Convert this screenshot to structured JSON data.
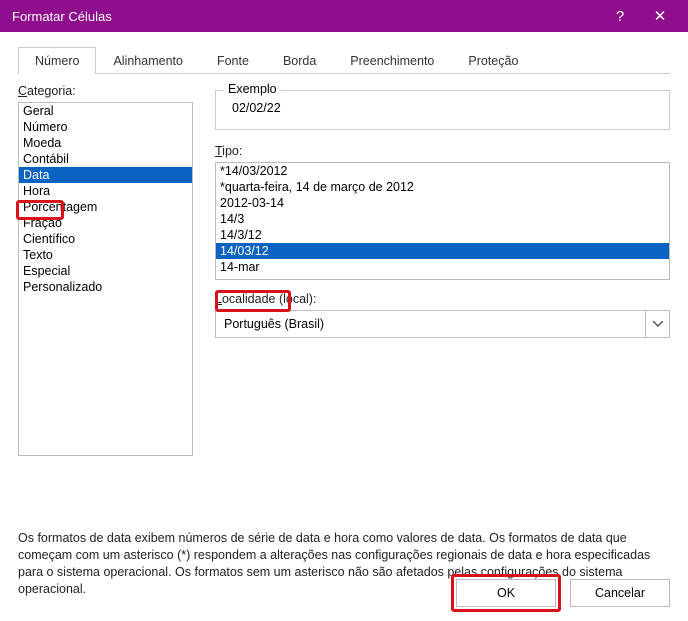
{
  "title": "Formatar Células",
  "tabs": [
    "Número",
    "Alinhamento",
    "Fonte",
    "Borda",
    "Preenchimento",
    "Proteção"
  ],
  "active_tab_index": 0,
  "labels": {
    "categoria": "Categoria:",
    "exemplo": "Exemplo",
    "tipo": "Tipo:",
    "localidade": "Localidade (local):"
  },
  "exemplo_value": "02/02/22",
  "categories": [
    "Geral",
    "Número",
    "Moeda",
    "Contábil",
    "Data",
    "Hora",
    "Porcentagem",
    "Fração",
    "Científico",
    "Texto",
    "Especial",
    "Personalizado"
  ],
  "selected_category_index": 4,
  "types": [
    "*14/03/2012",
    "*quarta-feira, 14 de março de 2012",
    "2012-03-14",
    "14/3",
    "14/3/12",
    "14/03/12",
    "14-mar"
  ],
  "selected_type_index": 5,
  "locale": "Português (Brasil)",
  "help_text": "Os formatos de data exibem números de série de data e hora como valores de data. Os formatos de data que começam com um asterisco (*) respondem a alterações nas configurações regionais de data e hora especificadas para o sistema operacional. Os formatos sem um asterisco não são afetados pelas configurações do sistema operacional.",
  "buttons": {
    "ok": "OK",
    "cancel": "Cancelar"
  }
}
